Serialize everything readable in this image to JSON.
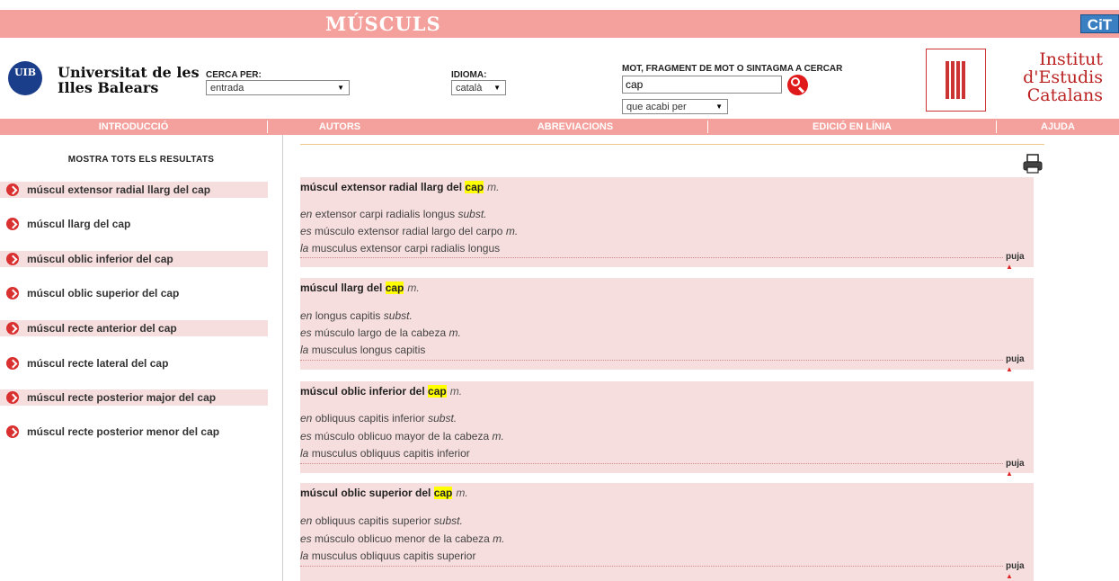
{
  "banner": {
    "title": "MÚSCULS",
    "badge": "CiT"
  },
  "uib": {
    "logo_text": "UIB",
    "name_line1": "Universitat de les",
    "name_line2": "Illes Balears"
  },
  "search": {
    "cerca_per_label": "CERCA PER:",
    "cerca_per_value": "entrada",
    "idioma_label": "IDIOMA:",
    "idioma_value": "català",
    "mot_label": "MOT, FRAGMENT DE MOT O SINTAGMA A CERCAR",
    "mot_value": "cap",
    "mode_value": "que acabi per"
  },
  "iec": {
    "line1": "Institut",
    "line2": "d'Estudis",
    "line3": "Catalans"
  },
  "nav": [
    "INTRODUCCIÓ",
    "AUTORS",
    "ABREVIACIONS",
    "EDICIÓ EN LÍNIA",
    "AJUDA"
  ],
  "sidebar": {
    "show_all": "MOSTRA TOTS ELS RESULTATS",
    "items": [
      "múscul extensor radial llarg del cap",
      "múscul llarg del cap",
      "múscul oblic inferior del cap",
      "múscul oblic superior del cap",
      "múscul recte anterior del cap",
      "múscul recte lateral del cap",
      "múscul recte posterior major del cap",
      "múscul recte posterior menor del cap"
    ]
  },
  "entries": [
    {
      "title_pre": "múscul extensor radial llarg del ",
      "title_hl": "cap",
      "gram": "m.",
      "en_code": "en",
      "en": "extensor carpi radialis longus",
      "en_gram": "subst.",
      "es_code": "es",
      "es": "músculo extensor radial largo del carpo",
      "es_gram": "m.",
      "la_code": "la",
      "la": "musculus extensor carpi radialis longus",
      "puja": "puja"
    },
    {
      "title_pre": "múscul llarg del ",
      "title_hl": "cap",
      "gram": "m.",
      "en_code": "en",
      "en": "longus capitis",
      "en_gram": "subst.",
      "es_code": "es",
      "es": "músculo largo de la cabeza",
      "es_gram": "m.",
      "la_code": "la",
      "la": "musculus longus capitis",
      "puja": "puja"
    },
    {
      "title_pre": "múscul oblic inferior del ",
      "title_hl": "cap",
      "gram": "m.",
      "en_code": "en",
      "en": "obliquus capitis inferior",
      "en_gram": "subst.",
      "es_code": "es",
      "es": "músculo oblicuo mayor de la cabeza",
      "es_gram": "m.",
      "la_code": "la",
      "la": "musculus obliquus capitis inferior",
      "puja": "puja"
    },
    {
      "title_pre": "múscul oblic superior del ",
      "title_hl": "cap",
      "gram": "m.",
      "en_code": "en",
      "en": "obliquus capitis superior",
      "en_gram": "subst.",
      "es_code": "es",
      "es": "músculo oblicuo menor de la cabeza",
      "es_gram": "m.",
      "la_code": "la",
      "la": "musculus obliquus capitis superior",
      "puja": "puja"
    }
  ]
}
